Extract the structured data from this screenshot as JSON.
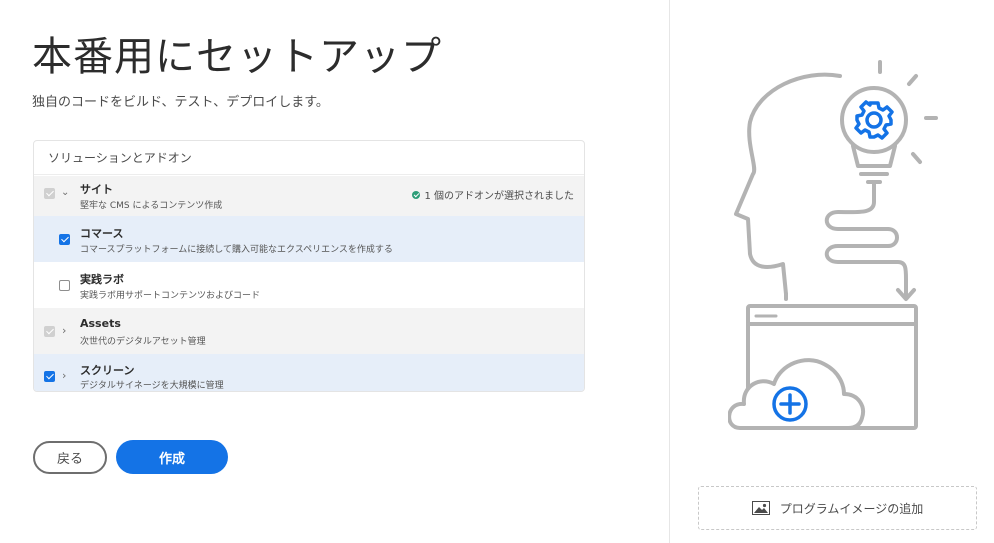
{
  "page": {
    "title": "本番用にセットアップ",
    "subtitle": "独自のコードをビルド、テスト、デプロイします。"
  },
  "panel": {
    "header": "ソリューションとアドオン",
    "rows": [
      {
        "title": "サイト",
        "desc": "堅牢な CMS によるコンテンツ作成",
        "state": "disabled-checked",
        "expander": "expanded",
        "status": "1 個のアドオンが選択されました"
      },
      {
        "title": "コマース",
        "desc": "コマースプラットフォームに接続して購入可能なエクスペリエンスを作成する",
        "state": "checked"
      },
      {
        "title": "実践ラボ",
        "desc": "実践ラボ用サポートコンテンツおよびコード",
        "state": "unchecked"
      },
      {
        "title": "Assets",
        "desc": "次世代のデジタルアセット管理",
        "state": "disabled-checked",
        "expander": "collapsed"
      },
      {
        "title": "スクリーン",
        "desc": "デジタルサイネージを大規模に管理",
        "state": "checked",
        "expander": "collapsed"
      }
    ]
  },
  "buttons": {
    "back": "戻る",
    "create": "作成"
  },
  "right": {
    "add_image": "プログラムイメージの追加"
  },
  "colors": {
    "accent": "#1473e6",
    "success": "#2d9d78",
    "illustration_stroke": "#b3b3b3"
  }
}
